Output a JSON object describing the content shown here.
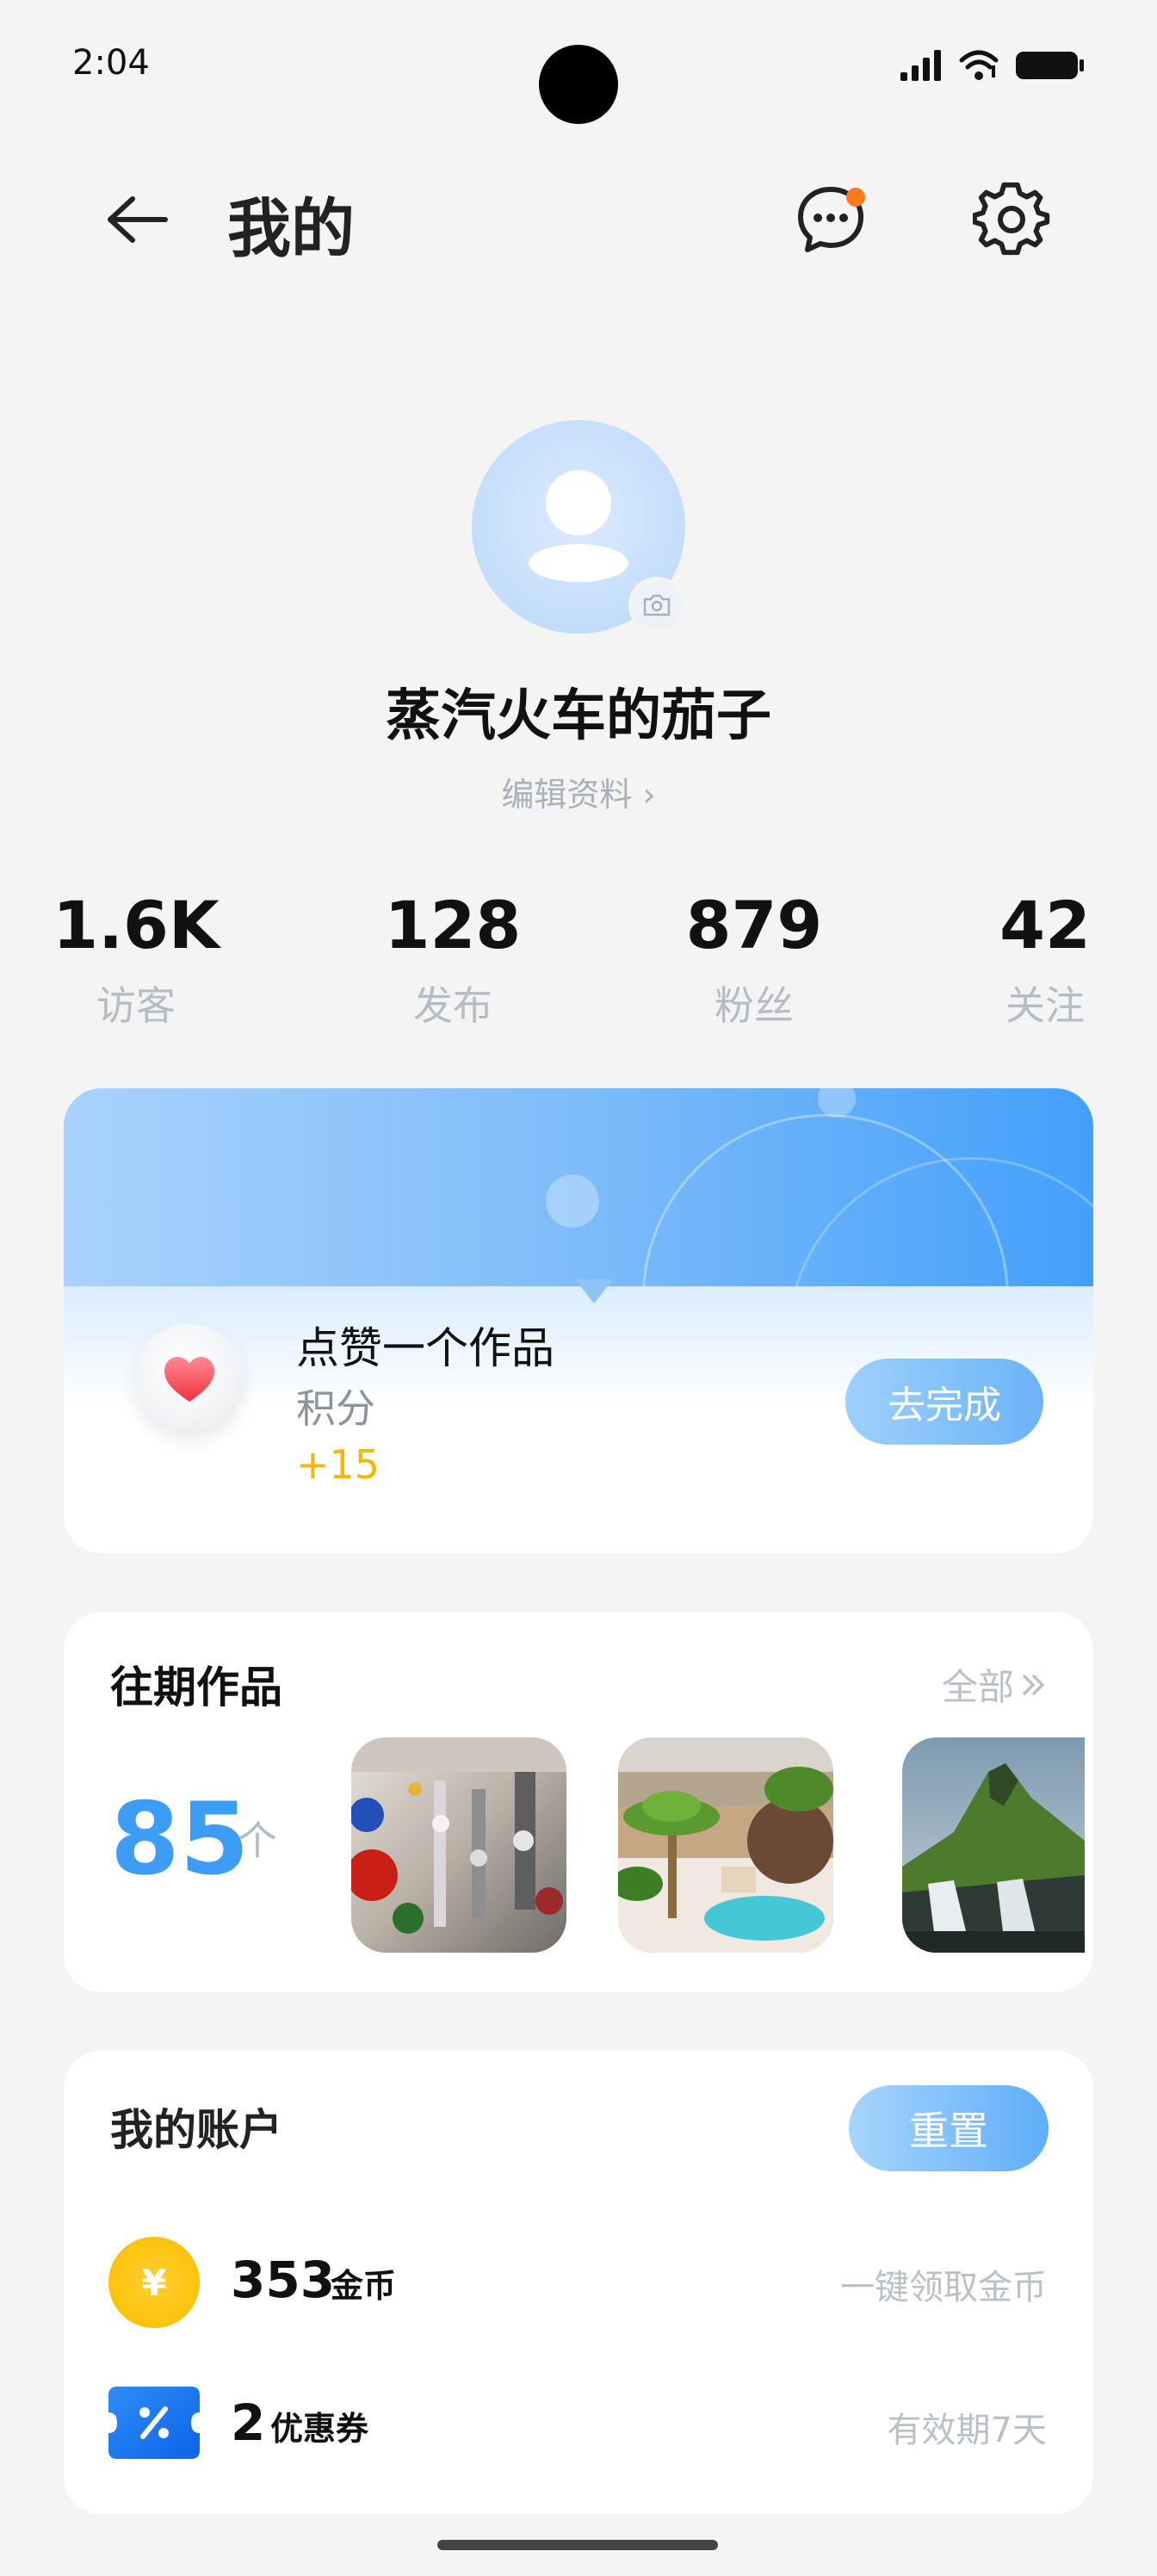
{
  "status_bar": {
    "time": "2:04"
  },
  "header": {
    "title": "我的"
  },
  "profile": {
    "nickname": "蒸汽火车的茄子",
    "edit_label": "编辑资料 ›"
  },
  "stats": [
    {
      "value": "1.6K",
      "label": "访客"
    },
    {
      "value": "128",
      "label": "发布"
    },
    {
      "value": "879",
      "label": "粉丝"
    },
    {
      "value": "42",
      "label": "关注"
    }
  ],
  "task": {
    "title": "点赞一个作品",
    "subtitle": "积分",
    "reward": "+15",
    "button_label": "去完成"
  },
  "works": {
    "title": "往期作品",
    "all_label": "全部",
    "count": "85",
    "unit": "个",
    "thumbnails": [
      "glass-ornaments-photo",
      "palm-courtyard-pool-photo",
      "mountain-waterfall-photo"
    ]
  },
  "account": {
    "title": "我的账户",
    "reset_label": "重置",
    "coins": {
      "amount": "353",
      "unit": "金币",
      "action": "一键领取金币",
      "symbol": "¥"
    },
    "coupons": {
      "amount": "2",
      "unit": "优惠券",
      "expiry": "有效期7天"
    }
  },
  "colors": {
    "accent": "#3d9cf5",
    "reward": "#f5b700",
    "notification": "#ff7a1a"
  }
}
